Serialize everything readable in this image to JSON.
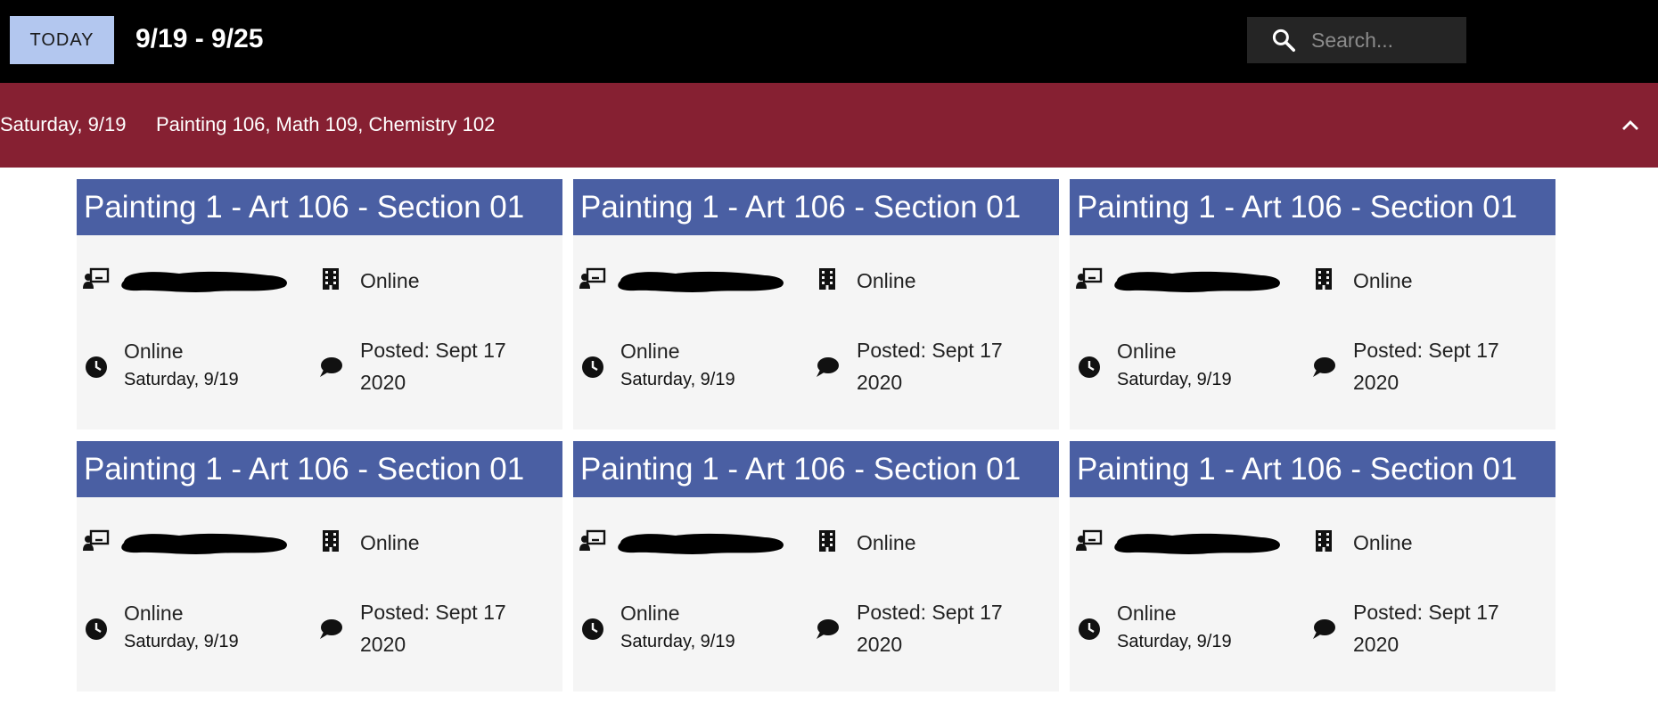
{
  "topbar": {
    "today_label": "TODAY",
    "date_range": "9/19 - 9/25",
    "search_placeholder": "Search..."
  },
  "day_header": {
    "date": "Saturday, 9/19",
    "courses": "Painting 106, Math 109, Chemistry 102",
    "collapse_icon": "chevron-up-icon"
  },
  "colors": {
    "topbar_bg": "#000000",
    "today_button_bg": "#b3c7ef",
    "day_header_bg": "#862032",
    "card_title_bg": "#4a5fa3",
    "card_bg": "#f5f5f5"
  },
  "cards": [
    {
      "title": "Painting 1 - Art 106 - Section 01",
      "location": "Online",
      "mode": "Online",
      "day": "Saturday, 9/19",
      "posted": "Posted: Sept 17 2020"
    },
    {
      "title": "Painting 1 - Art 106 - Section 01",
      "location": "Online",
      "mode": "Online",
      "day": "Saturday, 9/19",
      "posted": "Posted: Sept 17 2020"
    },
    {
      "title": "Painting 1 - Art 106 - Section 01",
      "location": "Online",
      "mode": "Online",
      "day": "Saturday, 9/19",
      "posted": "Posted: Sept 17 2020"
    },
    {
      "title": "Painting 1 - Art 106 - Section 01",
      "location": "Online",
      "mode": "Online",
      "day": "Saturday, 9/19",
      "posted": "Posted: Sept 17 2020"
    },
    {
      "title": "Painting 1 - Art 106 - Section 01",
      "location": "Online",
      "mode": "Online",
      "day": "Saturday, 9/19",
      "posted": "Posted: Sept 17 2020"
    },
    {
      "title": "Painting 1 - Art 106 - Section 01",
      "location": "Online",
      "mode": "Online",
      "day": "Saturday, 9/19",
      "posted": "Posted: Sept 17 2020"
    }
  ]
}
